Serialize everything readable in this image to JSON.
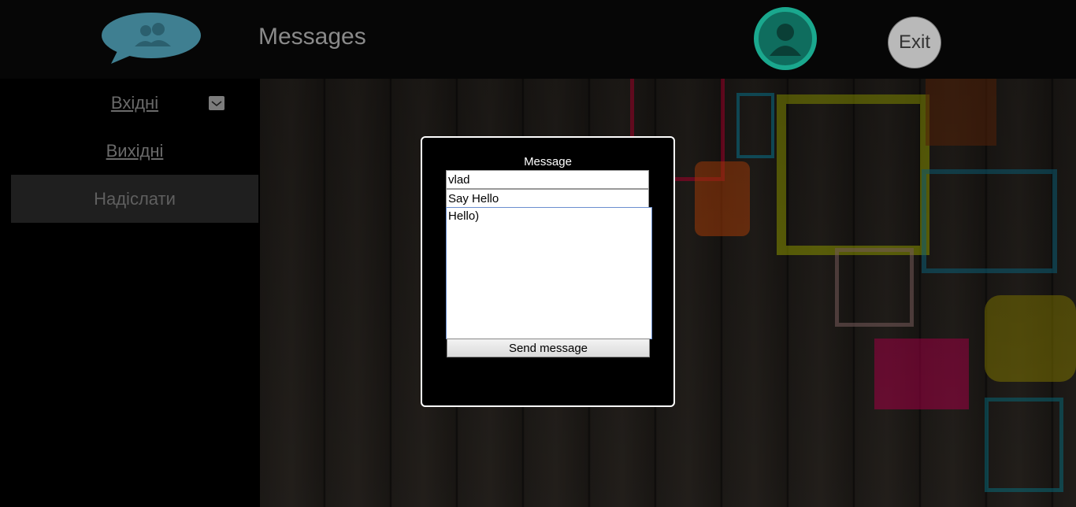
{
  "header": {
    "title": "Messages",
    "exit_label": "Exit"
  },
  "sidebar": {
    "items": [
      {
        "label": "Вхідні"
      },
      {
        "label": "Вихідні"
      },
      {
        "label": "Надіслати"
      }
    ]
  },
  "modal": {
    "title": "Message",
    "recipient": "vlad",
    "subject": "Say Hello",
    "body": "Hello)",
    "send_label": "Send message"
  }
}
